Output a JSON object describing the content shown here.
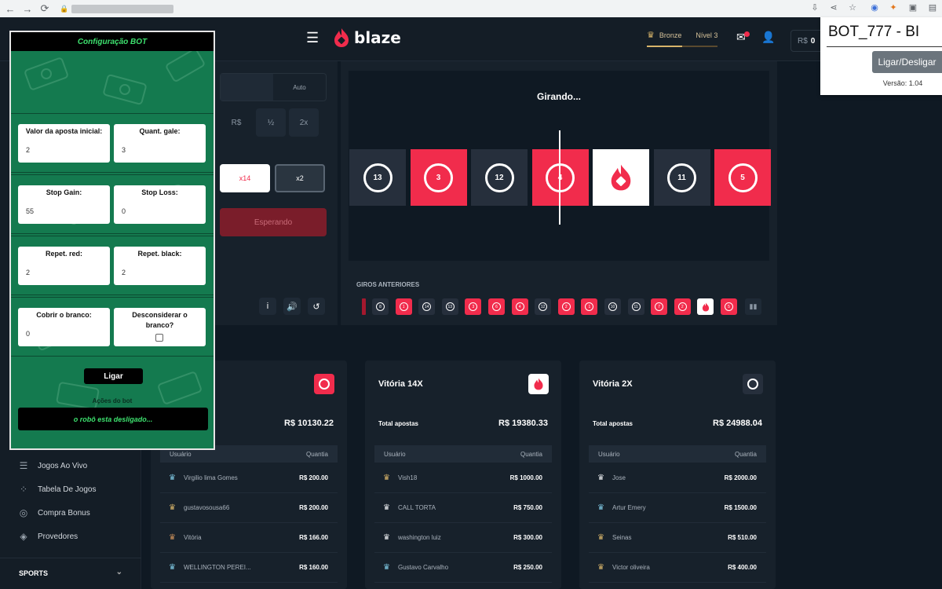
{
  "browser": {
    "url_hidden": true,
    "ext_icons": [
      "download-icon",
      "share-icon",
      "star-icon",
      "chrome-ext-icon",
      "metamask-icon",
      "ext-icon-3",
      "ext-icon-4"
    ]
  },
  "header": {
    "logo_text": "blaze",
    "rank_name": "Bronze",
    "rank_level": "Nível 3",
    "rank_progress": 0.5,
    "balance_currency": "R$",
    "balance_value": "0"
  },
  "sidebar": {
    "items": [
      {
        "label": "Jogos Ao Vivo",
        "icon": "live-games-icon"
      },
      {
        "label": "Tabela De Jogos",
        "icon": "games-table-icon"
      },
      {
        "label": "Compra Bonus",
        "icon": "bonus-icon"
      },
      {
        "label": "Provedores",
        "icon": "providers-icon"
      }
    ],
    "sports_label": "SPORTS"
  },
  "bet_panel": {
    "tab_auto": "Auto",
    "currency": "R$",
    "half_label": "½",
    "double_label": "2x",
    "partial_label": "r",
    "white_label": "x14",
    "black_label": "x2",
    "wait_label": "Esperando"
  },
  "roulette": {
    "status": "Girando...",
    "tiles": [
      {
        "color": "black",
        "number": "13"
      },
      {
        "color": "red",
        "number": "3"
      },
      {
        "color": "black",
        "number": "12"
      },
      {
        "color": "red",
        "number": "4"
      },
      {
        "color": "white",
        "number": ""
      },
      {
        "color": "black",
        "number": "11"
      },
      {
        "color": "red",
        "number": "5"
      }
    ],
    "history_label": "GIROS ANTERIORES",
    "history": [
      {
        "color": "black",
        "number": "8"
      },
      {
        "color": "red",
        "number": "1"
      },
      {
        "color": "black",
        "number": "14"
      },
      {
        "color": "black",
        "number": "13"
      },
      {
        "color": "red",
        "number": "3"
      },
      {
        "color": "red",
        "number": "6"
      },
      {
        "color": "red",
        "number": "4"
      },
      {
        "color": "black",
        "number": "12"
      },
      {
        "color": "red",
        "number": "2"
      },
      {
        "color": "red",
        "number": "1"
      },
      {
        "color": "black",
        "number": "10"
      },
      {
        "color": "black",
        "number": "11"
      },
      {
        "color": "red",
        "number": "7"
      },
      {
        "color": "red",
        "number": "2"
      },
      {
        "color": "white",
        "number": ""
      },
      {
        "color": "red",
        "number": "5"
      }
    ]
  },
  "cards": [
    {
      "title": "",
      "total_label": "",
      "total_value": "R$ 10130.22",
      "col_user": "Usuário",
      "col_amount": "Quantia",
      "rows": [
        {
          "name": "Virgilio lima Gomes",
          "amount": "R$ 200.00",
          "tier": "platinum"
        },
        {
          "name": "gustavosousa66",
          "amount": "R$ 200.00",
          "tier": "gold"
        },
        {
          "name": "Vitória",
          "amount": "R$ 166.00",
          "tier": "bronze"
        },
        {
          "name": "WELLINGTON PEREI...",
          "amount": "R$ 160.00",
          "tier": "platinum"
        }
      ]
    },
    {
      "title": "Vitória 14X",
      "total_label": "Total apostas",
      "total_value": "R$ 19380.33",
      "col_user": "Usuário",
      "col_amount": "Quantia",
      "rows": [
        {
          "name": "Vish18",
          "amount": "R$ 1000.00",
          "tier": "gold"
        },
        {
          "name": "CALL TORTA",
          "amount": "R$ 750.00",
          "tier": "silver"
        },
        {
          "name": "washington luiz",
          "amount": "R$ 300.00",
          "tier": "silver"
        },
        {
          "name": "Gustavo Carvalho",
          "amount": "R$ 250.00",
          "tier": "platinum"
        }
      ]
    },
    {
      "title": "Vitória 2X",
      "total_label": "Total apostas",
      "total_value": "R$ 24988.04",
      "col_user": "Usuário",
      "col_amount": "Quantia",
      "rows": [
        {
          "name": "Jose",
          "amount": "R$ 2000.00",
          "tier": "silver"
        },
        {
          "name": "Artur Emery",
          "amount": "R$ 1500.00",
          "tier": "platinum"
        },
        {
          "name": "Seinas",
          "amount": "R$ 510.00",
          "tier": "gold"
        },
        {
          "name": "Victor oliveira",
          "amount": "R$ 400.00",
          "tier": "gold"
        }
      ]
    }
  ],
  "bot": {
    "title": "Configuração BOT",
    "valor_label": "Valor da aposta inicial:",
    "valor_value": "2",
    "gale_label": "Quant. gale:",
    "gale_value": "3",
    "stopgain_label": "Stop Gain:",
    "stopgain_value": "55",
    "stoploss_label": "Stop Loss:",
    "stoploss_value": "0",
    "repred_label": "Repet. red:",
    "repred_value": "2",
    "repblack_label": "Repet. black:",
    "repblack_value": "2",
    "cobrir_label": "Cobrir o branco:",
    "cobrir_value": "0",
    "desconsiderar_label": "Desconsiderar o branco?",
    "ligar_label": "Ligar",
    "acoes_label": "Ações do bot",
    "status_text": "o robô esta desligado..."
  },
  "popup": {
    "title": "BOT_777 - BI",
    "button": "Ligar/Desligar",
    "version": "Versão: 1.04"
  },
  "colors": {
    "red": "#f12c4c",
    "dark_bg": "#0f1923",
    "panel": "#17212b",
    "bot_green": "#147a4f",
    "bot_text": "#3de06e"
  }
}
